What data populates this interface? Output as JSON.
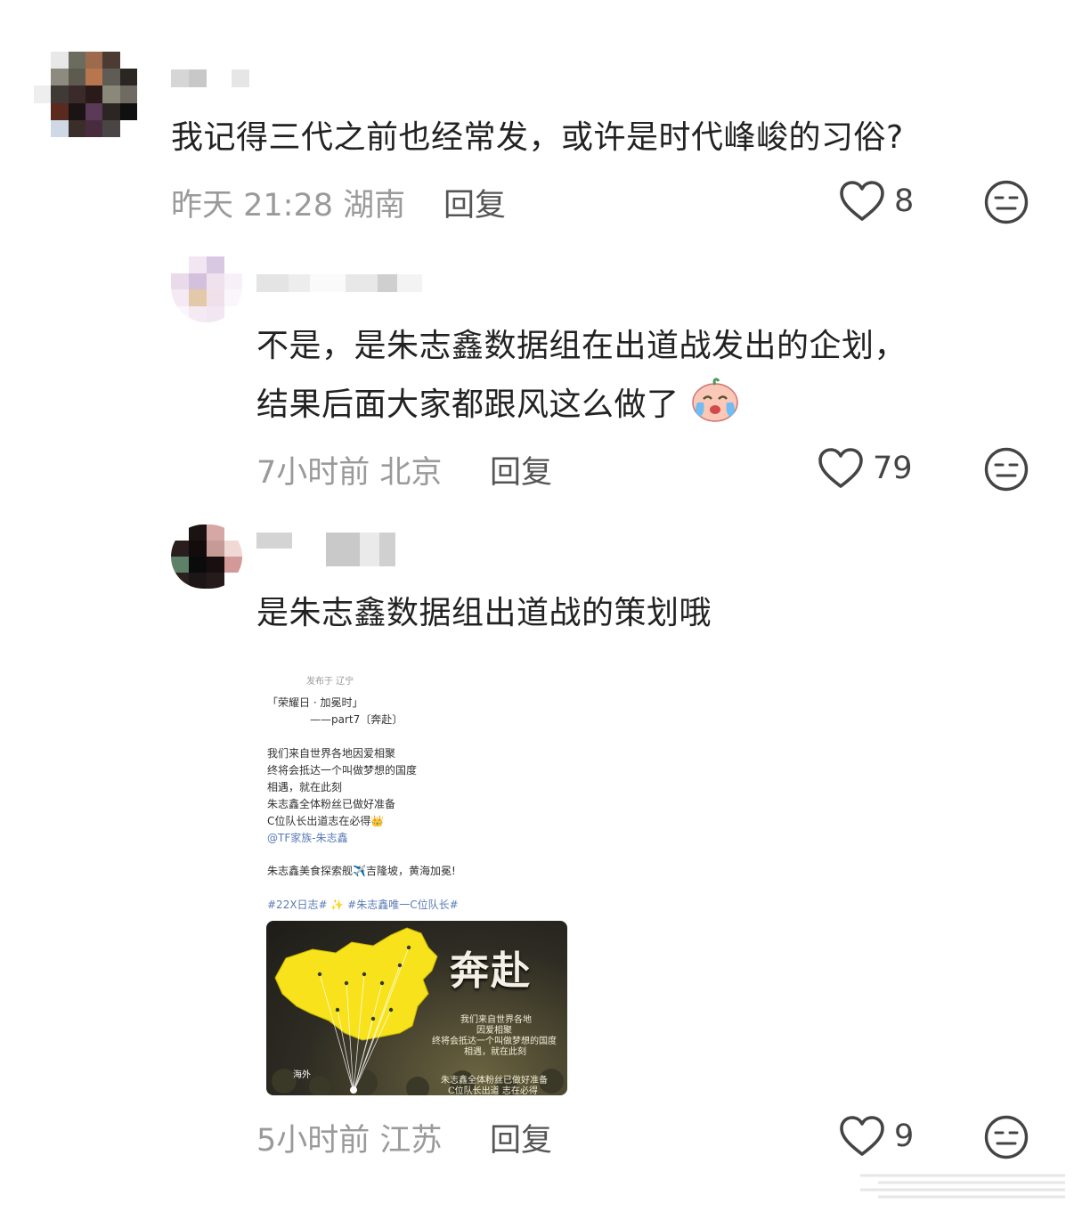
{
  "comments": [
    {
      "text": "我记得三代之前也经常发，或许是时代峰峻的习俗?",
      "time": "昨天 21:28",
      "location": "湖南",
      "reply_label": "回复",
      "likes": "8"
    },
    {
      "text_line1": "不是，是朱志鑫数据组在出道战发出的企划，",
      "text_line2": "结果后面大家都跟风这么做了",
      "time": "7小时前",
      "location": "北京",
      "reply_label": "回复",
      "likes": "79"
    },
    {
      "text": "是朱志鑫数据组出道战的策划哦",
      "time": "5小时前",
      "location": "江苏",
      "reply_label": "回复",
      "likes": "9",
      "attachment": {
        "published_in": "发布于 辽宁",
        "line_title": "「荣耀日 · 加冕时」",
        "line_part": "——part7〔奔赴〕",
        "body": [
          "我们来自世界各地因爱相聚",
          "终将会抵达一个叫做梦想的国度",
          "相遇，就在此刻",
          "朱志鑫全体粉丝已做好准备",
          "C位队长出道志在必得👑"
        ],
        "mention": "@TF家族-朱志鑫",
        "line_trip": "朱志鑫美食探索舰✈️吉隆坡，黄海加冕!",
        "tags": "#22X日志# ✨  #朱志鑫唯一C位队长#",
        "map": {
          "title": "奔赴",
          "sub1": "我们来自世界各地",
          "sub2": "因爱相聚",
          "sub3": "终将会抵达一个叫做梦想的国度",
          "sub4": "相遇，就在此刻",
          "sub5": "朱志鑫全体粉丝已做好准备",
          "sub6": "C位队长出道 志在必得",
          "overseas": "海外"
        }
      }
    }
  ],
  "colors": {
    "meta_gray": "#9a9a9a",
    "map_yellow": "#f7e21b"
  }
}
